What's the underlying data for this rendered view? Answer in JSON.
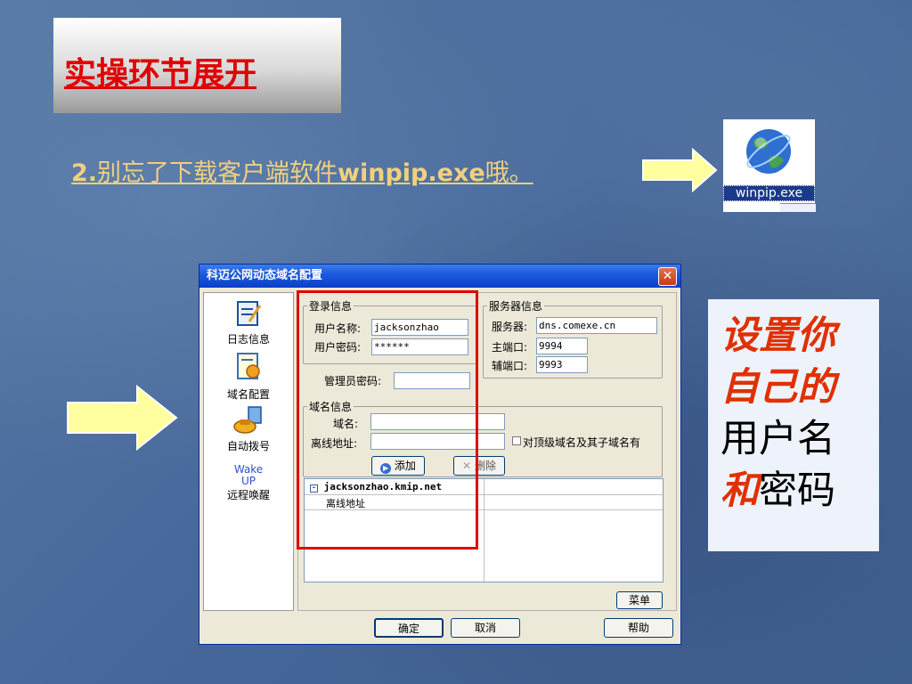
{
  "slide": {
    "title": "实操环节展开",
    "subtitle_num": "2.",
    "subtitle_text": "别忘了下载客户端软件",
    "subtitle_file": "winpip.exe",
    "subtitle_end": "哦。"
  },
  "winpip_icon": {
    "label": "winpip.exe",
    "icon": "globe-icon"
  },
  "note": {
    "line1": "设置你",
    "line2": "自己的",
    "line3": "用户名",
    "line4_red": "和",
    "line4_black": "密码"
  },
  "dialog": {
    "title": "科迈公网动态域名配置",
    "close": "✕",
    "sidebar": [
      {
        "label": "日志信息",
        "icon": "log-icon"
      },
      {
        "label": "域名配置",
        "icon": "domain-config-icon"
      },
      {
        "label": "自动拨号",
        "icon": "dialer-icon"
      },
      {
        "label": "远程唤醒",
        "icon_text": "Wake\nUP"
      }
    ],
    "login": {
      "legend": "登录信息",
      "username_label": "用户名称:",
      "username_value": "jacksonzhao",
      "password_label": "用户密码:",
      "password_value": "******",
      "admin_label": "管理员密码:",
      "admin_value": ""
    },
    "server": {
      "legend": "服务器信息",
      "server_label": "服务器:",
      "server_value": "dns.comexe.cn",
      "main_port_label": "主端口:",
      "main_port_value": "9994",
      "aux_port_label": "辅端口:",
      "aux_port_value": "9993"
    },
    "domain": {
      "legend": "域名信息",
      "domain_label": "域名:",
      "domain_value": "",
      "offline_label": "离线地址:",
      "offline_value": "",
      "checkbox_text": "对顶级域名及其子域名有",
      "add_button": "添加",
      "delete_button": "删除"
    },
    "tree": {
      "root": "jacksonzhao.kmip.net",
      "child": "离线地址"
    },
    "menu_button": "菜单",
    "ok_button": "确定",
    "cancel_button": "取消",
    "help_button": "帮助"
  },
  "colors": {
    "title_red": "#e00000",
    "subtitle_gold": "#f0d080",
    "arrow_yellow": "#ffffa0",
    "highlight_red": "#e00000"
  }
}
